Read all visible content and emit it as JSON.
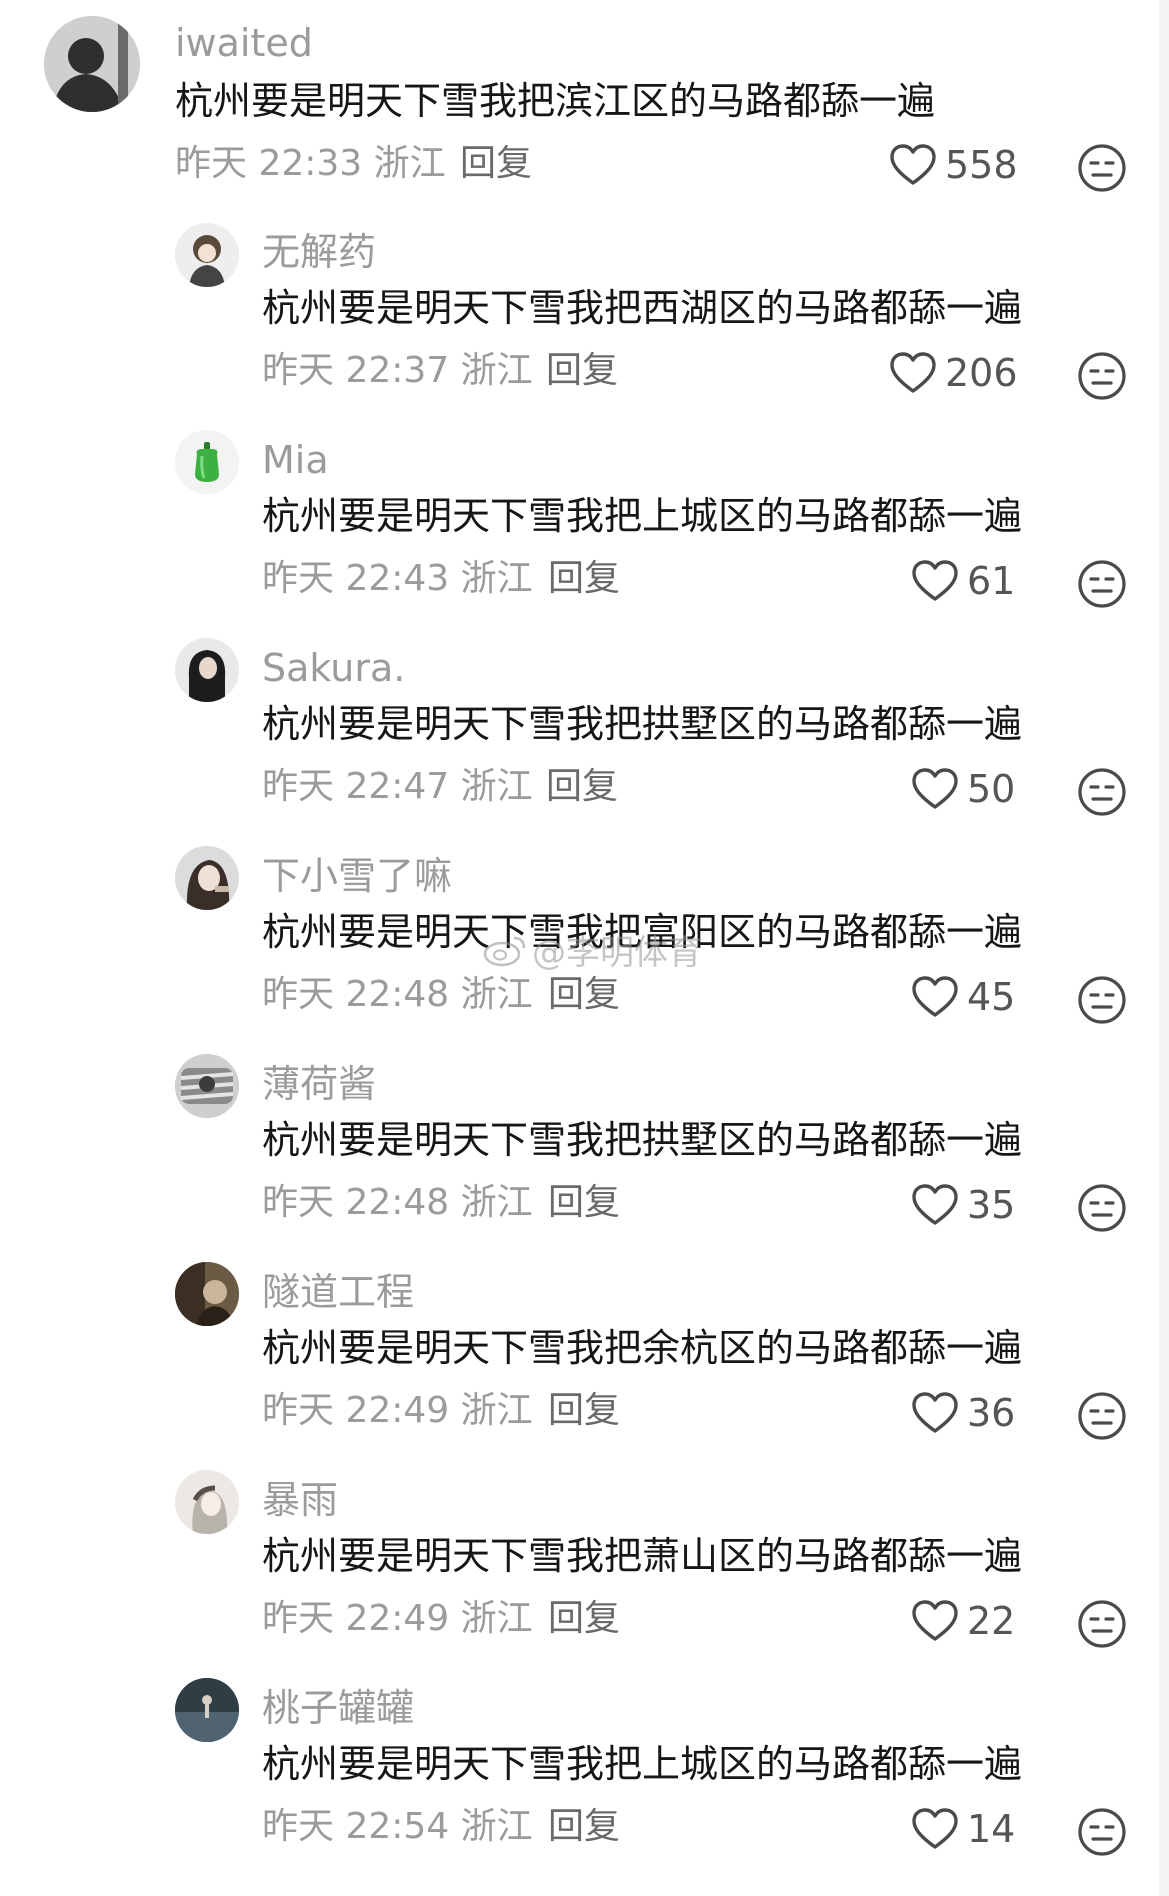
{
  "comments": [
    {
      "user": "iwaited",
      "text": "杭州要是明天下雪我把滨江区的马路都舔一遍",
      "meta": "昨天 22:33 浙江",
      "reply": "回复",
      "likes": "558",
      "avatar_icon": "user-avatar-icon",
      "avatar_color": "#2f2f2f"
    },
    {
      "user": "无解药",
      "text": "杭州要是明天下雪我把西湖区的马路都舔一遍",
      "meta": "昨天 22:37 浙江",
      "reply": "回复",
      "likes": "206",
      "avatar_icon": "user-avatar-icon",
      "avatar_color": "#5a4a3a"
    },
    {
      "user": "Mia",
      "text": "杭州要是明天下雪我把上城区的马路都舔一遍",
      "meta": "昨天 22:43 浙江",
      "reply": "回复",
      "likes": "61",
      "avatar_icon": "green-pepper-avatar-icon",
      "avatar_color": "#3cb043"
    },
    {
      "user": "Sakura.",
      "text": "杭州要是明天下雪我把拱墅区的马路都舔一遍",
      "meta": "昨天 22:47 浙江",
      "reply": "回复",
      "likes": "50",
      "avatar_icon": "user-avatar-icon",
      "avatar_color": "#1d1d1d"
    },
    {
      "user": "下小雪了嘛",
      "text": "杭州要是明天下雪我把富阳区的马路都舔一遍",
      "meta": "昨天 22:48 浙江",
      "reply": "回复",
      "likes": "45",
      "avatar_icon": "user-avatar-icon",
      "avatar_color": "#3a2e2a"
    },
    {
      "user": "薄荷酱",
      "text": "杭州要是明天下雪我把拱墅区的马路都舔一遍",
      "meta": "昨天 22:48 浙江",
      "reply": "回复",
      "likes": "35",
      "avatar_icon": "user-avatar-icon",
      "avatar_color": "#8a8a8a"
    },
    {
      "user": "隧道工程",
      "text": "杭州要是明天下雪我把余杭区的马路都舔一遍",
      "meta": "昨天 22:49 浙江",
      "reply": "回复",
      "likes": "36",
      "avatar_icon": "user-avatar-icon",
      "avatar_color": "#4a3b28"
    },
    {
      "user": "暴雨",
      "text": "杭州要是明天下雪我把萧山区的马路都舔一遍",
      "meta": "昨天 22:49 浙江",
      "reply": "回复",
      "likes": "22",
      "avatar_icon": "user-avatar-icon",
      "avatar_color": "#b9b3ad"
    },
    {
      "user": "桃子罐罐",
      "text": "杭州要是明天下雪我把上城区的马路都舔一遍",
      "meta": "昨天 22:54 浙江",
      "reply": "回复",
      "likes": "14",
      "avatar_icon": "user-avatar-icon",
      "avatar_color": "#3a4a52"
    }
  ],
  "watermark": "@李明体育",
  "colors": {
    "username": "#9b9b9b",
    "text": "#161616",
    "meta": "#9b9b9b",
    "icon": "#4a4a4a"
  }
}
